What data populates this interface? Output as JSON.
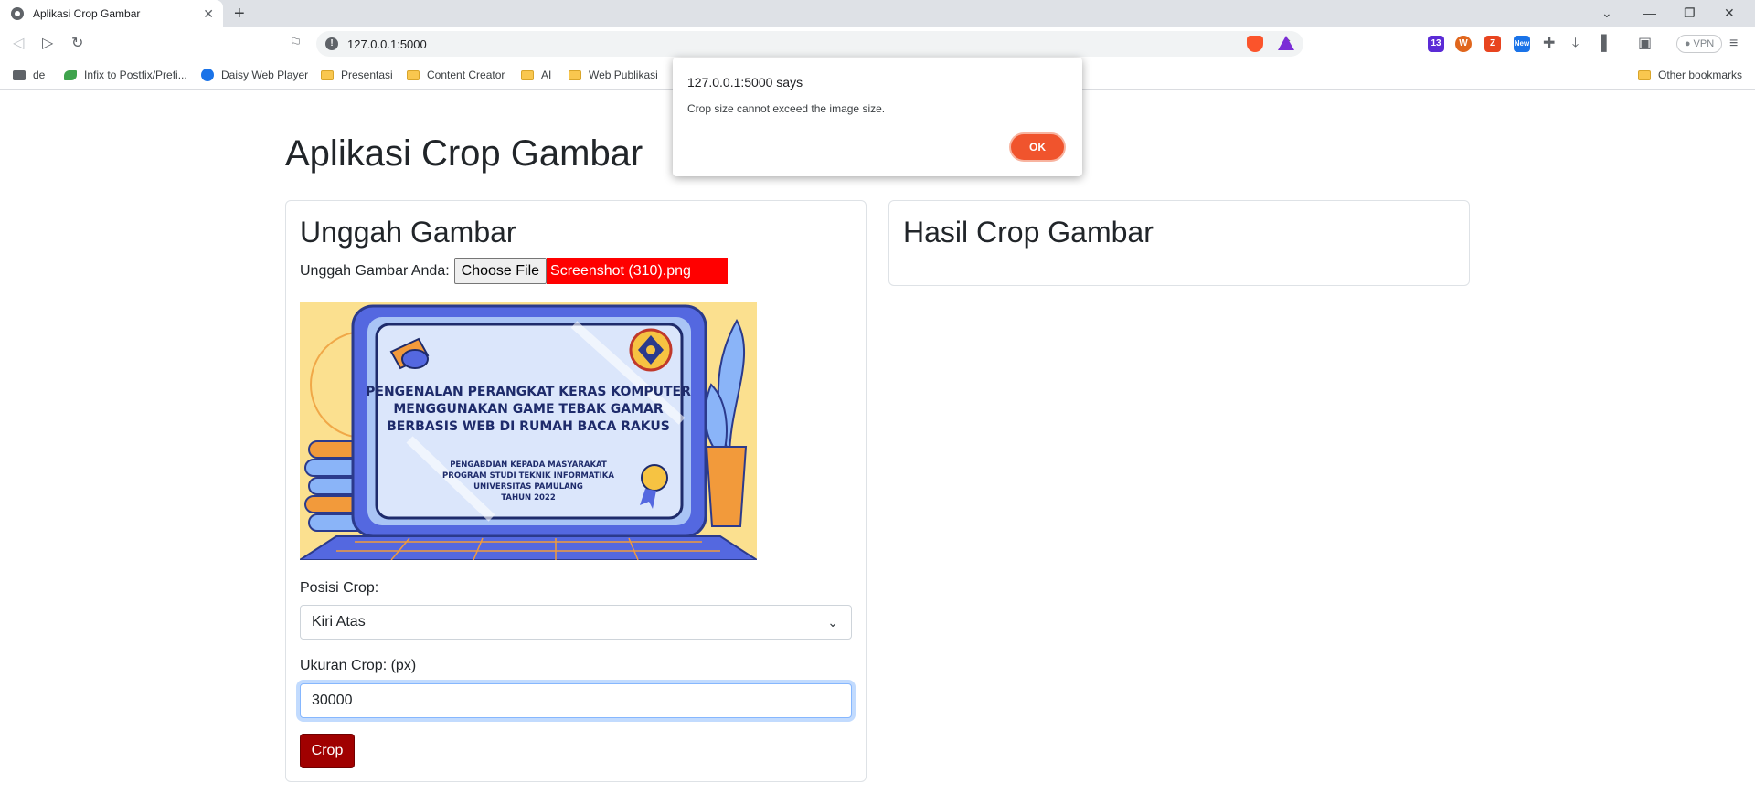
{
  "browser": {
    "tab_title": "Aplikasi Crop Gambar",
    "url": "127.0.0.1:5000",
    "vpn_label": "VPN",
    "extensions": [
      {
        "name": "graduation-cap-ext",
        "badge": "13",
        "color": "#5b2bd6"
      },
      {
        "name": "wordpress-ext",
        "color": "#e0661d"
      },
      {
        "name": "z-ext",
        "color": "#e8441f"
      },
      {
        "name": "new-ext",
        "badge": "New",
        "color": "#1a73e8"
      }
    ],
    "bookmarks": [
      {
        "label": "de",
        "icon": "spreadsheet-icon"
      },
      {
        "label": "Infix to Postfix/Prefi...",
        "icon": "leaf-icon"
      },
      {
        "label": "Daisy Web Player",
        "icon": "daisy-icon"
      },
      {
        "label": "Presentasi",
        "icon": "folder-icon"
      },
      {
        "label": "Content Creator",
        "icon": "folder-icon"
      },
      {
        "label": "AI",
        "icon": "folder-icon"
      },
      {
        "label": "Web Publikasi",
        "icon": "folder-icon"
      }
    ],
    "other_bookmarks": "Other bookmarks"
  },
  "page": {
    "title": "Aplikasi Crop Gambar",
    "upload_card": {
      "heading": "Unggah Gambar",
      "upload_label": "Unggah Gambar Anda:",
      "choose_file": "Choose File",
      "file_name": "Screenshot (310).png",
      "preview": {
        "line1": "PENGENALAN PERANGKAT KERAS KOMPUTER",
        "line2": "MENGGUNAKAN GAME TEBAK GAMAR",
        "line3": "BERBASIS WEB DI RUMAH BACA RAKUS",
        "sub1": "PENGABDIAN KEPADA MASYARAKAT",
        "sub2": "PROGRAM STUDI TEKNIK INFORMATIKA",
        "sub3": "UNIVERSITAS PAMULANG",
        "sub4": "TAHUN 2022"
      },
      "position_label": "Posisi Crop:",
      "position_value": "Kiri Atas",
      "size_label": "Ukuran Crop: (px)",
      "size_value": "30000",
      "crop_button": "Crop"
    },
    "result_card": {
      "heading": "Hasil Crop Gambar"
    }
  },
  "dialog": {
    "origin": "127.0.0.1:5000 says",
    "message": "Crop size cannot exceed the image size.",
    "ok": "OK"
  }
}
